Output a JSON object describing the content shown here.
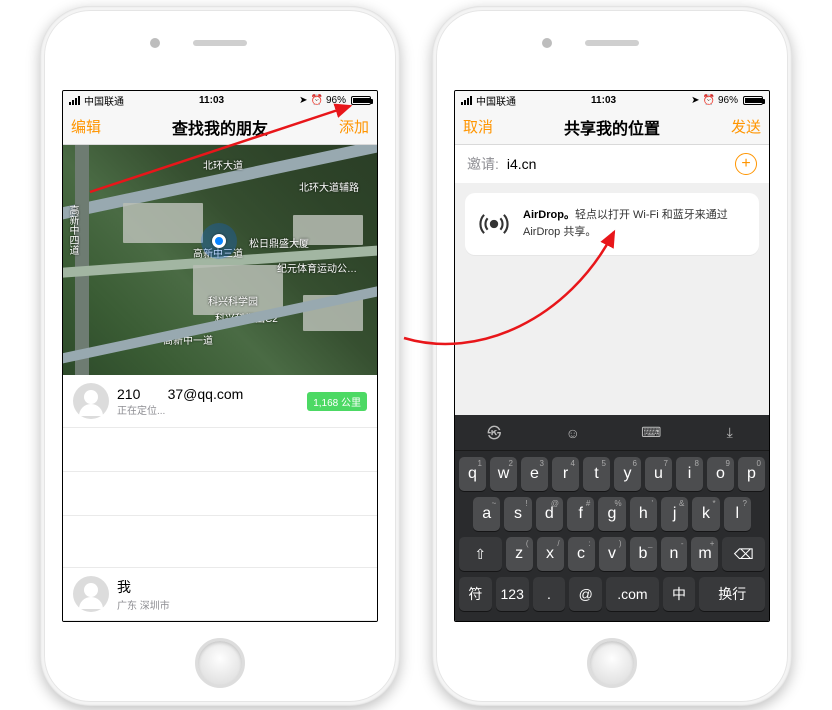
{
  "status": {
    "carrier": "中国联通",
    "time": "11:03",
    "battery": "96%"
  },
  "left": {
    "nav": {
      "left": "编辑",
      "title": "查找我的朋友",
      "right": "添加"
    },
    "map": {
      "roads": {
        "top": "北环大道",
        "top_aux": "北环大道辅路",
        "mid_near_pin": "高新中三道",
        "bottom": "高新中一道"
      },
      "places": {
        "a": "科兴科学园",
        "b": "科兴科学园C2",
        "c": "松日鼎盛大厦",
        "d": "纪元体育运动公…",
        "v_road": "高新中四道"
      }
    },
    "friend": {
      "name_left": "210",
      "name_right": "37@qq.com",
      "sub": "正在定位...",
      "distance": "1,168 公里"
    },
    "me": {
      "name": "我",
      "sub": "广东 深圳市"
    }
  },
  "right": {
    "nav": {
      "left": "取消",
      "title": "共享我的位置",
      "right": "发送"
    },
    "invite": {
      "label": "邀请:",
      "value": "i4.cn"
    },
    "airdrop": {
      "title": "AirDrop。",
      "body": "轻点以打开 Wi-Fi 和蓝牙来通过 AirDrop 共享。"
    },
    "keyboard": {
      "row1": [
        "q",
        "w",
        "e",
        "r",
        "t",
        "y",
        "u",
        "i",
        "o",
        "p"
      ],
      "row1n": [
        "1",
        "2",
        "3",
        "4",
        "5",
        "6",
        "7",
        "8",
        "9",
        "0"
      ],
      "row2": [
        "a",
        "s",
        "d",
        "f",
        "g",
        "h",
        "j",
        "k",
        "l"
      ],
      "row2n": [
        "~",
        "!",
        "@",
        "#",
        "%",
        "'",
        "&",
        "*",
        "?"
      ],
      "row3": [
        "z",
        "x",
        "c",
        "v",
        "b",
        "n",
        "m"
      ],
      "row3n": [
        "(",
        "/",
        ":",
        ")",
        "_",
        "-",
        "+"
      ],
      "row4": {
        "sym": "符",
        "num": "123",
        "dot": ".",
        "at": "@",
        "com": ".com",
        "lang": "中",
        "enter": "换行"
      }
    }
  }
}
